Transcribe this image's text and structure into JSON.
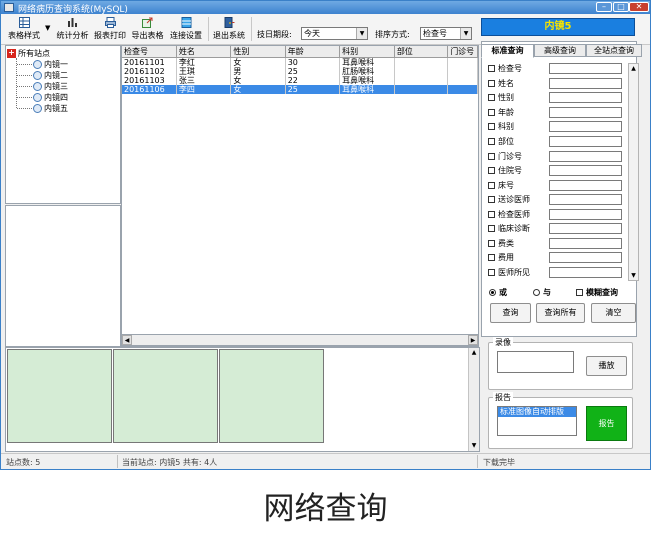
{
  "window": {
    "title": "网络病历查询系统(MySQL)",
    "station_banner": "内镜5",
    "colors": {
      "titlebar": "#3d82cf",
      "banner_bg": "#1a7fe0",
      "banner_text": "#f5e300",
      "selected_row": "#3b8ae6",
      "thumbnail": "#d5ecd5",
      "report_button": "#11b217"
    }
  },
  "toolbar": {
    "buttons": [
      {
        "label": "表格样式",
        "icon": "grid-icon"
      },
      {
        "label": "统计分析",
        "icon": "bar-chart-icon"
      },
      {
        "label": "报表打印",
        "icon": "printer-icon"
      },
      {
        "label": "导出表格",
        "icon": "export-icon"
      },
      {
        "label": "连接设置",
        "icon": "database-icon"
      },
      {
        "label": "退出系统",
        "icon": "exit-icon"
      }
    ],
    "period_label": "技日期段:",
    "period_value": "今天",
    "sort_label": "排序方式:",
    "sort_value": "检查号"
  },
  "tree": {
    "root": "所有站点",
    "nodes": [
      "内镜一",
      "内镜二",
      "内镜三",
      "内镜四",
      "内镜五"
    ]
  },
  "grid": {
    "columns": [
      "检查号",
      "姓名",
      "性别",
      "年龄",
      "科别",
      "部位",
      "门诊号"
    ],
    "rows": [
      [
        "20161101",
        "李红",
        "女",
        "30",
        "耳鼻喉科",
        "",
        ""
      ],
      [
        "20161102",
        "王琪",
        "男",
        "25",
        "肛肠喉科",
        "",
        ""
      ],
      [
        "20161103",
        "张三",
        "女",
        "22",
        "耳鼻喉科",
        "",
        ""
      ],
      [
        "20161106",
        "李四",
        "女",
        "25",
        "耳鼻喉科",
        "",
        ""
      ]
    ],
    "selected_row": 3
  },
  "search": {
    "tabs": [
      "标准查询",
      "高级查询",
      "全站点查询"
    ],
    "active_tab": 0,
    "fields": [
      "检查号",
      "姓名",
      "性别",
      "年龄",
      "科别",
      "部位",
      "门诊号",
      "住院号",
      "床号",
      "送诊医师",
      "检查医师",
      "临床诊断",
      "费类",
      "费用",
      "医师所见"
    ],
    "logic_or": "或",
    "logic_and": "与",
    "fuzzy": "模糊查询",
    "btn_query": "查询",
    "btn_query_all": "查询所有",
    "btn_clear": "清空"
  },
  "recording": {
    "legend": "录像",
    "play_button": "播放"
  },
  "report": {
    "legend": "报告",
    "template": "标准图像自动排版",
    "report_button": "报告"
  },
  "status": {
    "stations": "站点数: 5",
    "current": "当前站点: 内镜5  共有: 4人",
    "message": "下载完毕"
  },
  "caption": "网络查询"
}
